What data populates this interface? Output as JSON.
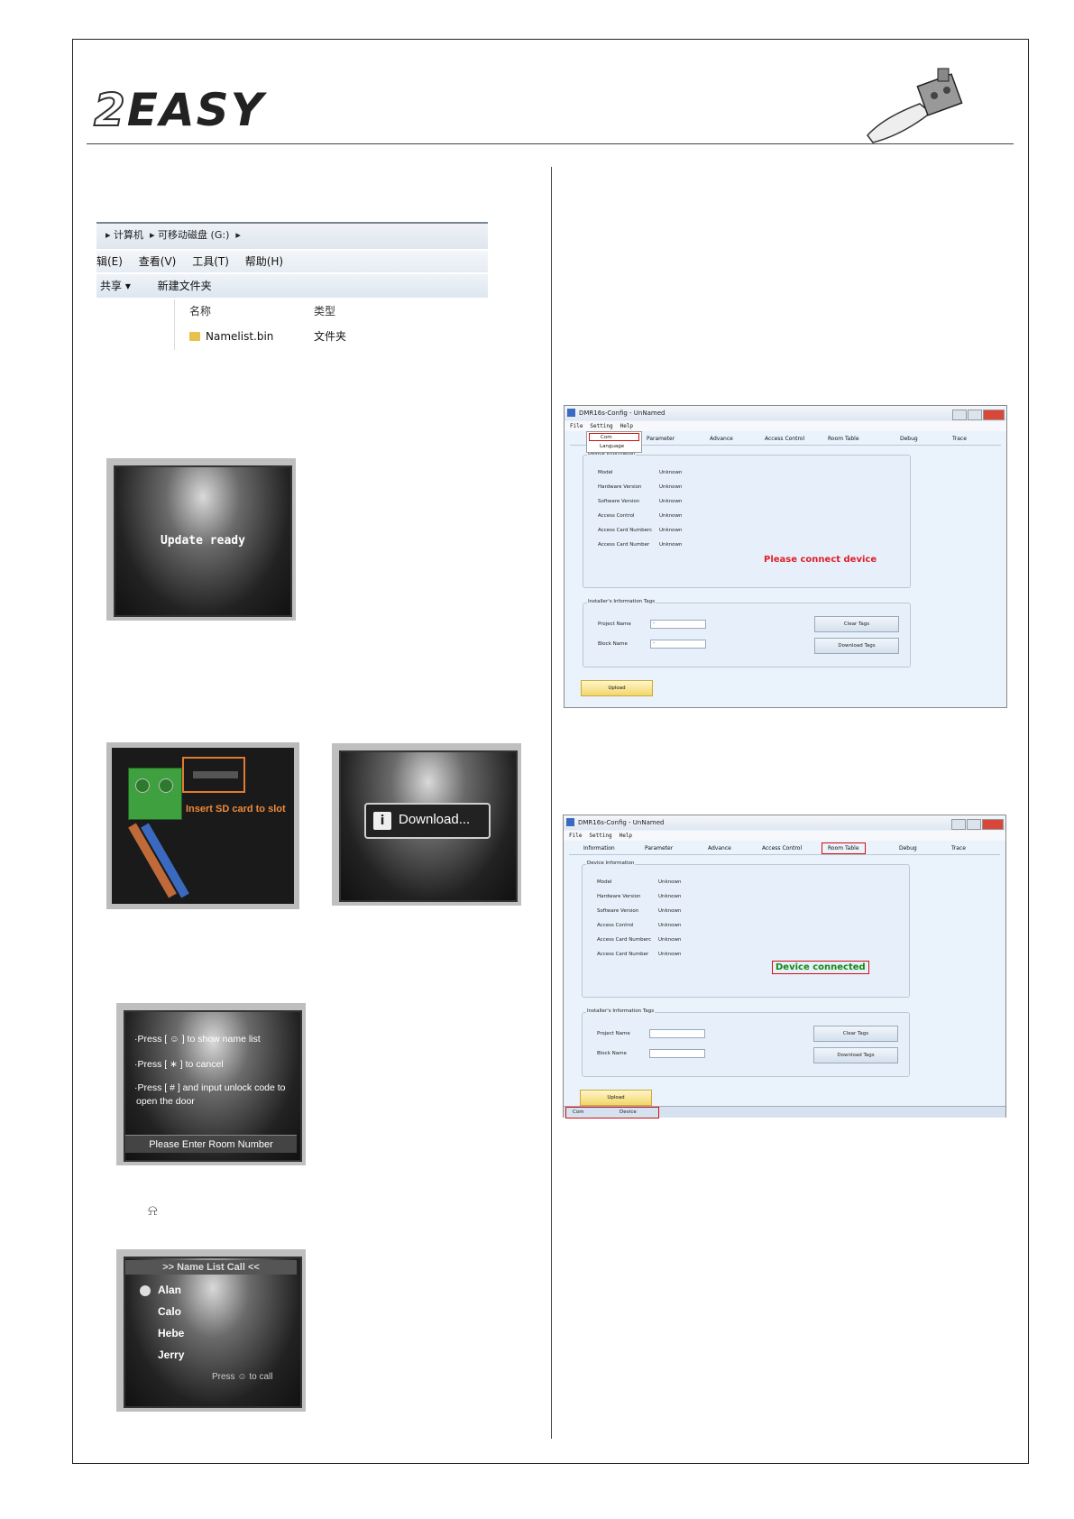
{
  "logo": {
    "text_two": "2",
    "text_rest": "EASY"
  },
  "explorer": {
    "breadcrumb": [
      "计算机",
      "可移动磁盘 (G:)"
    ],
    "menu": [
      "辑(E)",
      "查看(V)",
      "工具(T)",
      "帮助(H)"
    ],
    "toolbar": [
      "共享 ▾",
      "新建文件夹"
    ],
    "col_name": "名称",
    "col_type": "类型",
    "file_name": "Namelist.bin",
    "file_type": "文件夹"
  },
  "update_screen": {
    "text": "Update ready"
  },
  "sd_photo": {
    "label": "Insert SD card to slot"
  },
  "download_screen": {
    "text": "Download..."
  },
  "room_screen": {
    "lines": [
      "·Press [ ☺ ] to show name list",
      "·Press [ ∗ ] to cancel",
      "·Press [ # ] and input unlock code to",
      "open the door"
    ],
    "footer": "Please Enter Room Number"
  },
  "bell": {
    "glyph": "⍾"
  },
  "namelist_screen": {
    "header": ">> Name List Call <<",
    "names": [
      "Alan",
      "Calo",
      "Hebe",
      "Jerry"
    ],
    "footer": "Press ☺ to call"
  },
  "app": {
    "title": "DMR16s-Config - UnNamed",
    "menu": [
      "File",
      "Setting",
      "Help"
    ],
    "submenu": [
      "Com",
      "Language"
    ],
    "tabs": [
      "Information",
      "Parameter",
      "Advance",
      "Access Control",
      "Room Table",
      "Debug",
      "Trace"
    ],
    "device_group": "Device Information",
    "fields": [
      "Model",
      "Hardware Version",
      "Software Version",
      "Access Control",
      "Access Card Numberc",
      "Access Card Number"
    ],
    "field_value": "Unknown",
    "installer_group": "Installer's Information Tags",
    "project_name": "Project Name",
    "block_name": "Block Name",
    "input_value": "-",
    "clear_tags": "Clear Tags",
    "download_tags": "Download Tags",
    "upload": "Upload",
    "msg_disconnected": "Please connect device",
    "msg_connected": "Device connected",
    "status_com": "Com",
    "status_device": "Device",
    "colors": {
      "red": "#e0202a",
      "green": "#118a11"
    }
  }
}
